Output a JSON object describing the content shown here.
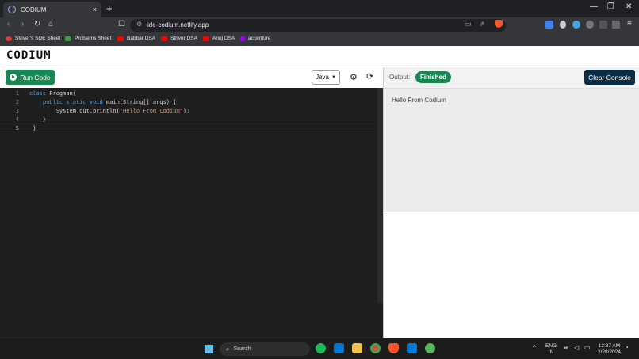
{
  "browser": {
    "tab_title": "CODIUM",
    "tab_close": "×",
    "new_tab": "+",
    "url": "ide-codium.netlify.app",
    "window_controls": [
      "—",
      "❐",
      "✕"
    ]
  },
  "bookmarks": [
    {
      "label": "Striver's SDE Sheet",
      "color": "#e53935"
    },
    {
      "label": "Problems Sheet",
      "color": "#43a047"
    },
    {
      "label": "Babbar DSA",
      "color": "#ff0000"
    },
    {
      "label": "Striver DSA",
      "color": "#ff0000"
    },
    {
      "label": "Anuj DSA",
      "color": "#ff0000"
    },
    {
      "label": "accenture",
      "color": "#a100ff"
    }
  ],
  "app": {
    "logo": "CODIUM",
    "run_label": "Run Code",
    "language": "Java",
    "output_label": "Output:",
    "status": "Finished",
    "clear_label": "Clear Console",
    "console_output": "Hello From Codium"
  },
  "editor": {
    "line_numbers": [
      "1",
      "2",
      "3",
      "4",
      "5"
    ],
    "lines": [
      {
        "kw": "class",
        "rest": " Progman{"
      },
      {
        "indent": "    ",
        "kw": "public static void",
        "rest": " main(String[] args) {"
      },
      {
        "indent": "        ",
        "pre": "System.out.println(",
        "str": "\"Hello From Codium\"",
        "post": ");"
      },
      {
        "indent": "    ",
        "rest": "}"
      },
      {
        "indent": " ",
        "rest": "}"
      }
    ]
  },
  "taskbar": {
    "search_label": "Search",
    "lang_top": "ENG",
    "lang_bottom": "IN",
    "time": "12:37 AM",
    "date": "2/28/2024"
  },
  "colors": {
    "run_button": "#198754",
    "status_badge": "#198754",
    "clear_button": "#0b2c45",
    "editor_bg": "#1e1e1e",
    "keyword": "#569cd6",
    "string": "#ce9178"
  }
}
